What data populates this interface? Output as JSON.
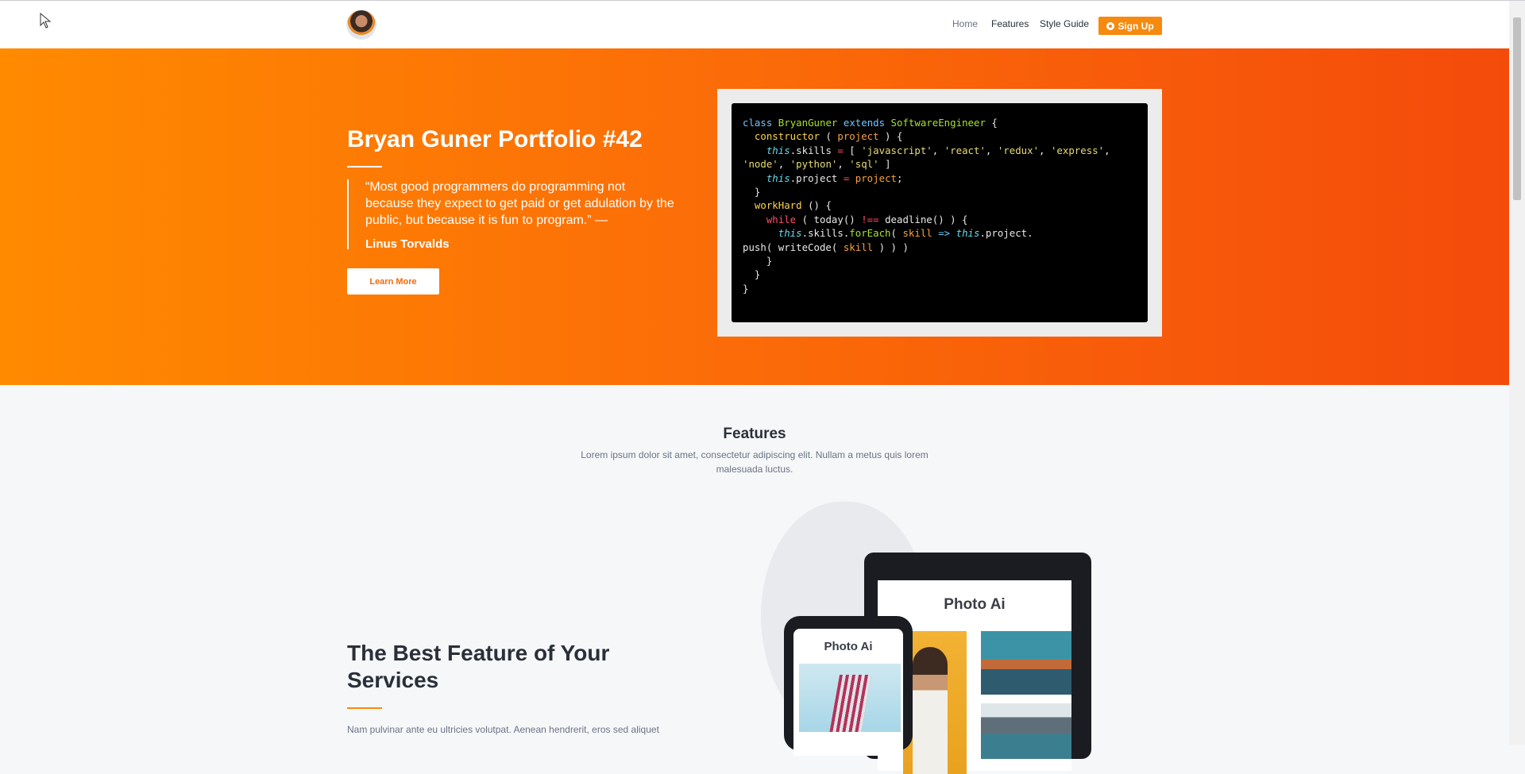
{
  "header": {
    "nav": [
      "Home",
      "Features",
      "Style Guide"
    ],
    "signup_label": "Sign Up"
  },
  "hero": {
    "title": "Bryan Guner Portfolio #42",
    "quote": "“Most good programmers do programming not because they expect to get paid or get adulation by the public, but because it is fun to program.” —",
    "quote_author": "Linus Torvalds",
    "button_label": "Learn More"
  },
  "code": {
    "lines": [
      "class BryanGuner extends SoftwareEngineer {",
      "  constructor ( project ) {",
      "    this.skills = [ 'javascript', 'react', 'redux', 'express',",
      "'node', 'python', 'sql' ]",
      "    this.project = project;",
      "  }",
      "  workHard () {",
      "    while ( today() !== deadline() ) {",
      "      this.skills.forEach( skill => this.project.",
      "push( writeCode( skill ) ) )",
      "    }",
      "  }",
      "}"
    ]
  },
  "features": {
    "title": "Features",
    "subtitle": "Lorem ipsum dolor sit amet, consectetur adipiscing elit. Nullam a metus quis lorem malesuada luctus."
  },
  "best": {
    "title": "The Best Feature of Your Services",
    "text": "Nam pulvinar ante eu ultricies volutpat. Aenean hendrerit, eros sed aliquet"
  },
  "devices": {
    "tablet_title": "Photo Ai",
    "phone_title": "Photo Ai"
  },
  "colors": {
    "accent": "#f68a0f",
    "hero_start": "#ff8a00",
    "hero_end": "#f44b0b"
  }
}
